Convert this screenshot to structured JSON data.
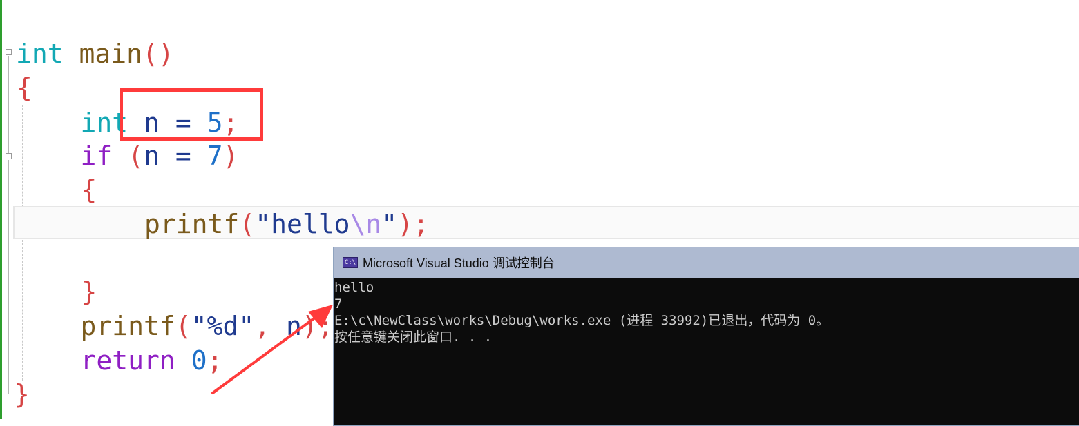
{
  "editor": {
    "lines": [
      {
        "parts": [
          {
            "t": "int",
            "c": "kw-type"
          },
          {
            "t": " "
          },
          {
            "t": "main",
            "c": "fn"
          },
          {
            "t": "()",
            "c": "punc"
          }
        ]
      },
      {
        "parts": [
          {
            "t": "{",
            "c": "punc"
          }
        ]
      },
      {
        "parts": [
          {
            "t": "    "
          },
          {
            "t": "int",
            "c": "kw-type"
          },
          {
            "t": " "
          },
          {
            "t": "n",
            "c": "var"
          },
          {
            "t": " = ",
            "c": "var"
          },
          {
            "t": "5",
            "c": "num"
          },
          {
            "t": ";",
            "c": "punc"
          }
        ]
      },
      {
        "parts": [
          {
            "t": "    "
          },
          {
            "t": "if",
            "c": "kw-ctrl"
          },
          {
            "t": " "
          },
          {
            "t": "(",
            "c": "punc"
          },
          {
            "t": "n",
            "c": "var"
          },
          {
            "t": " = ",
            "c": "var"
          },
          {
            "t": "7",
            "c": "num"
          },
          {
            "t": ")",
            "c": "punc"
          }
        ]
      },
      {
        "parts": [
          {
            "t": "    "
          },
          {
            "t": "{",
            "c": "punc"
          }
        ]
      },
      {
        "parts": [
          {
            "t": "        "
          },
          {
            "t": "printf",
            "c": "fn"
          },
          {
            "t": "(",
            "c": "punc"
          },
          {
            "t": "\"hello",
            "c": "str"
          },
          {
            "t": "\\n",
            "c": "esc"
          },
          {
            "t": "\"",
            "c": "str"
          },
          {
            "t": ");",
            "c": "punc"
          }
        ]
      },
      {
        "parts": [
          {
            "t": ""
          }
        ]
      },
      {
        "parts": [
          {
            "t": "    "
          },
          {
            "t": "}",
            "c": "punc"
          }
        ]
      },
      {
        "parts": [
          {
            "t": "    "
          },
          {
            "t": "printf",
            "c": "fn"
          },
          {
            "t": "(",
            "c": "punc"
          },
          {
            "t": "\"%d\"",
            "c": "str"
          },
          {
            "t": ", ",
            "c": "punc"
          },
          {
            "t": "n",
            "c": "var"
          },
          {
            "t": ");",
            "c": "punc"
          }
        ]
      },
      {
        "parts": [
          {
            "t": "    "
          },
          {
            "t": "return",
            "c": "kw-ctrl"
          },
          {
            "t": " "
          },
          {
            "t": "0",
            "c": "num"
          },
          {
            "t": ";",
            "c": "punc"
          }
        ]
      },
      {
        "parts": [
          {
            "t": "}",
            "c": "punc"
          }
        ]
      }
    ]
  },
  "console": {
    "title": "Microsoft Visual Studio 调试控制台",
    "icon_label": "C:\\",
    "icon": "console-app-icon",
    "lines": [
      "hello",
      "7",
      "E:\\c\\NewClass\\works\\Debug\\works.exe (进程 33992)已退出，代码为 0。",
      "按任意键关闭此窗口. . ."
    ]
  },
  "colors": {
    "annotation_red": "#ff3b3b",
    "console_bg": "#0c0c0c",
    "title_bar": "#aebad1"
  }
}
